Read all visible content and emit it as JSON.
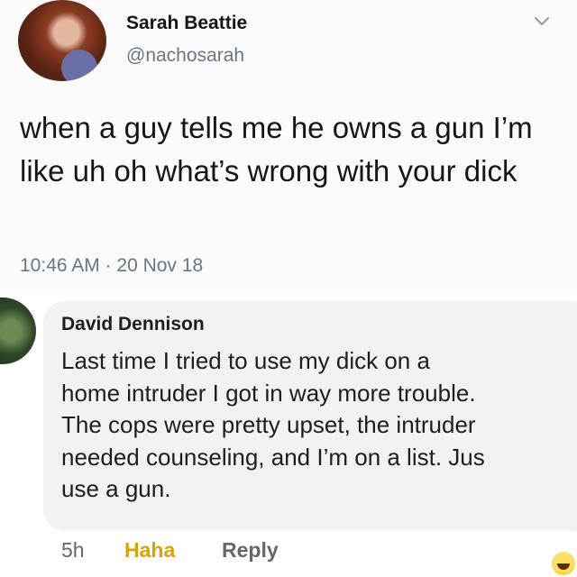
{
  "tweet": {
    "name": "Sarah Beattie",
    "handle": "@nachosarah",
    "text": "when a guy tells me he owns a gun I’m like uh oh what’s wrong with your dick",
    "timestamp": "10:46 AM · 20 Nov 18"
  },
  "comment": {
    "name": "David Dennison",
    "lines": [
      "Last time I tried to use my dick on a",
      "home intruder I got in way more trouble.",
      "The cops were pretty upset, the intruder",
      "needed counseling, and I’m on a list. Jus",
      "use a gun."
    ],
    "time": "5h",
    "haha_label": "Haha",
    "reply_label": "Reply",
    "reaction_icon": "laughing-emoji-icon"
  },
  "colors": {
    "secondary_text": "#657786",
    "comment_bubble": "#f0f2f5",
    "haha": "#d9a206"
  }
}
